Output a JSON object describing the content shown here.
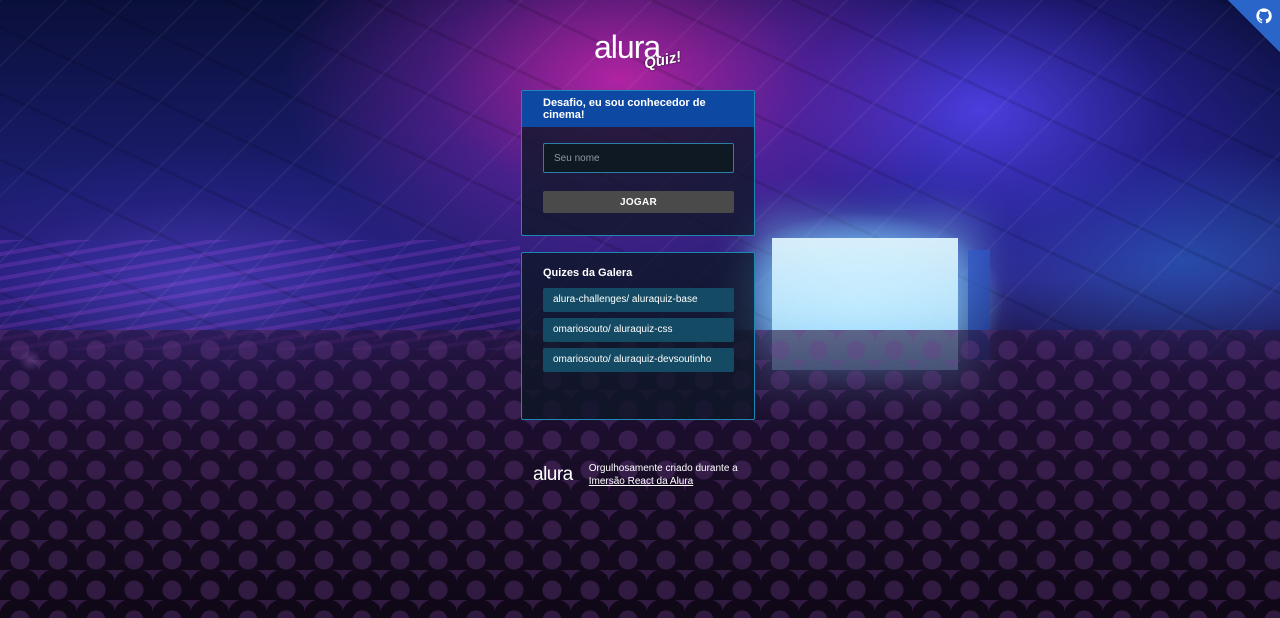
{
  "logo": {
    "brand": "alura",
    "badge": "Quiz!"
  },
  "quiz_widget": {
    "title": "Desafio, eu sou conhecedor de cinema!",
    "name_input": {
      "placeholder": "Seu nome",
      "value": ""
    },
    "play_label": "JOGAR"
  },
  "community_widget": {
    "title": "Quizes da Galera",
    "items": [
      {
        "label": "alura-challenges/ aluraquiz-base"
      },
      {
        "label": "omariosouto/ aluraquiz-css"
      },
      {
        "label": "omariosouto/ aluraquiz-devsoutinho"
      }
    ]
  },
  "footer": {
    "brand": "alura",
    "text_prefix": "Orgulhosamente criado durante a",
    "link_text": "Imersão React da Alura"
  },
  "icons": {
    "github_corner": "octocat-icon"
  },
  "colors": {
    "widget_header": "#0d49a3",
    "widget_border": "#1e88b5",
    "widget_bg": "#0e1726",
    "link_bg": "#144a63",
    "button_bg": "#4a4a4a",
    "github_corner": "#2a66c9"
  }
}
